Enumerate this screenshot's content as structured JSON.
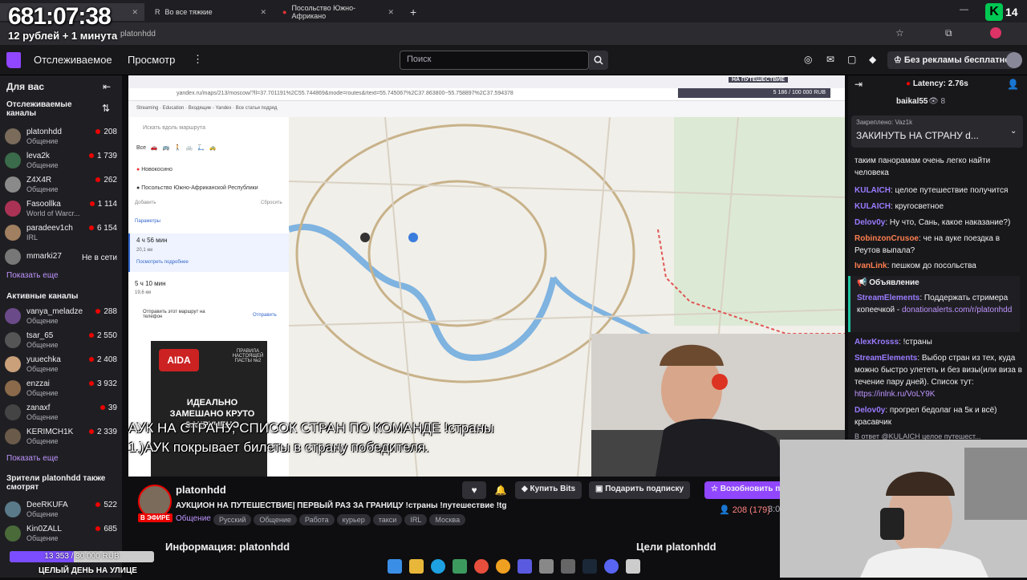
{
  "overlay": {
    "timer": "681:07:38",
    "rate": "12 рублей + 1 минута"
  },
  "browser": {
    "tabs": [
      {
        "label": "Во все тяжкие"
      },
      {
        "label": "Посольство Южно-Африкано"
      }
    ],
    "url": "platonhdd",
    "new_tab": "+"
  },
  "twitch_nav": {
    "following": "Отслеживаемое",
    "browse": "Просмотр",
    "more": "⋮",
    "search_placeholder": "Поиск",
    "no_ads": "Без рекламы бесплатно",
    "badge": "14"
  },
  "sidebar": {
    "for_you": "Для вас",
    "followed_header": "Отслеживаемые каналы",
    "followed": [
      {
        "name": "platonhdd",
        "category": "Общение",
        "viewers": "208",
        "color": "#7a6b5a"
      },
      {
        "name": "leva2k",
        "category": "Общение",
        "viewers": "1 739",
        "color": "#3a6b4a"
      },
      {
        "name": "Z4X4R",
        "category": "Общение",
        "viewers": "262",
        "color": "#8a8a8a"
      },
      {
        "name": "Fasoollka",
        "category": "World of Warcr...",
        "viewers": "1 114",
        "color": "#aa3355"
      },
      {
        "name": "paradeev1ch",
        "category": "IRL",
        "viewers": "6 154",
        "color": "#a08060"
      },
      {
        "name": "mmarki27",
        "category": "",
        "viewers": "Не в сети",
        "color": "#777"
      }
    ],
    "show_more_1": "Показать еще",
    "active_header": "Активные каналы",
    "active": [
      {
        "name": "vanya_meladze",
        "category": "Общение",
        "viewers": "288",
        "color": "#6b4a8a"
      },
      {
        "name": "tsar_65",
        "category": "Общение",
        "viewers": "2 550",
        "color": "#555"
      },
      {
        "name": "yuuechka",
        "category": "Общение",
        "viewers": "2 408",
        "color": "#c9a07a"
      },
      {
        "name": "enzzai",
        "category": "Общение",
        "viewers": "3 932",
        "color": "#8a6a4a"
      },
      {
        "name": "zanaxf",
        "category": "Общение",
        "viewers": "39",
        "color": "#444"
      },
      {
        "name": "KERIMCH1K",
        "category": "Общение",
        "viewers": "2 339",
        "color": "#6a5a4a"
      }
    ],
    "show_more_2": "Показать еще",
    "also_header": "Зрители platonhdd также смотрят",
    "also": [
      {
        "name": "DeeRKUFA",
        "category": "Общение",
        "viewers": "522",
        "color": "#5a7a8a"
      },
      {
        "name": "Kin0ZALL",
        "category": "Общение",
        "viewers": "685",
        "color": "#4a6a3a"
      }
    ]
  },
  "stream": {
    "subtitle_line1": "АУК НА СТРАНУ, СПИСОК СТРАН ПО КОМАНДЕ !страны",
    "subtitle_line2": "1.)АУК покрывает билеты в страну победителя.",
    "map_counter": "5 186 / 100 000 RUB",
    "map_banner": "НА ПУТЕШЕСТВИЕ",
    "route_search": "Искать вдоль маршрута",
    "route_from": "Новокосино",
    "route_to": "Посольство Южно-Африканской Республики",
    "route_add": "Добавить",
    "route_reset": "Сбросить",
    "params": "Параметры",
    "route1_time": "4 ч 56 мин",
    "route1_dist": "20,1 км",
    "route1_more": "Посмотреть подробнее",
    "route2_time": "5 ч 10 мин",
    "route2_dist": "19,6 км",
    "send_phone": "Отправить этот маршрут на телефон",
    "send_btn": "Отправить",
    "ad_brand": "AIDA",
    "ad_title": "ПРАВИЛА НАСТОЯЩЕЙ ПАСТЫ №2",
    "ad_text": "ИДЕАЛЬНО ЗАМЕШАНО КРУТО ЗАКРУЧЕНО"
  },
  "info": {
    "channel": "platonhdd",
    "title": "АУКЦИОН НА ПУТЕШЕСТВИЕ| ПЕРВЫЙ РАЗ ЗА ГРАНИЦУ !страны !путешествие !tg",
    "live": "В ЭФИРЕ",
    "category": "Общение",
    "tags": [
      "Русский",
      "Общение",
      "Работа",
      "курьер",
      "такси",
      "IRL",
      "Москва"
    ],
    "bits": "Купить Bits",
    "gift": "Подарить подписку",
    "subscribe": "Возобновить по",
    "viewers": "208 (179)",
    "uptime": "3:0",
    "about": "Информация: platonhdd",
    "goals": "Цели platonhdd"
  },
  "goal_bar": {
    "text": "13 353 / 30 000 RUB",
    "fraction": 0.445,
    "caption": "ЦЕЛЫЙ ДЕНЬ НА УЛИЦЕ"
  },
  "chat": {
    "latency": "Latency: 2.76s",
    "top_user": "baikal55",
    "top_count": "8",
    "pinned_by": "Закреплено: Vaz1k",
    "pinned_text": "ЗАКИНУТЬ НА СТРАНУ d...",
    "messages": [
      {
        "user": "",
        "text": "таким панорамам очень легко найти человека",
        "color": "#efeff1"
      },
      {
        "user": "KULAICH",
        "text": ": целое путешествие получится",
        "color": "#9b7bff"
      },
      {
        "user": "KULAICH",
        "text": ": кругосветное",
        "color": "#9b7bff"
      },
      {
        "user": "Delov0y",
        "text": ": Ну что, Сань, какое наказание?)",
        "color": "#9b7bff"
      },
      {
        "user": "RobinzonCrusoe",
        "text": ": че на ауке поездка в Реутов выпала?",
        "color": "#ff7f50"
      },
      {
        "user": "IvanLink",
        "text": ": пешком до посольства",
        "color": "#ff7f50"
      }
    ],
    "announce": "Объявление",
    "se1_user": "StreamElements",
    "se1_text": ": Поддержать стримера копеечкой -",
    "se1_link": "donationalerts.com/r/platonhdd",
    "ak_user": "AlexKrosss",
    "ak_text": ": !страны",
    "se2_user": "StreamElements",
    "se2_text": ": Выбор стран из тех, куда можно быстро улететь и без визы(или виза в течение пару дней). Список тут:",
    "se2_link": "https://inlnk.ru/VoLY9K",
    "d_user": "Delov0y",
    "d_text": ": прогрел бедолаг на 5к и всё) красавчик",
    "reply": "В ответ @KULAICH целое путешест..."
  }
}
